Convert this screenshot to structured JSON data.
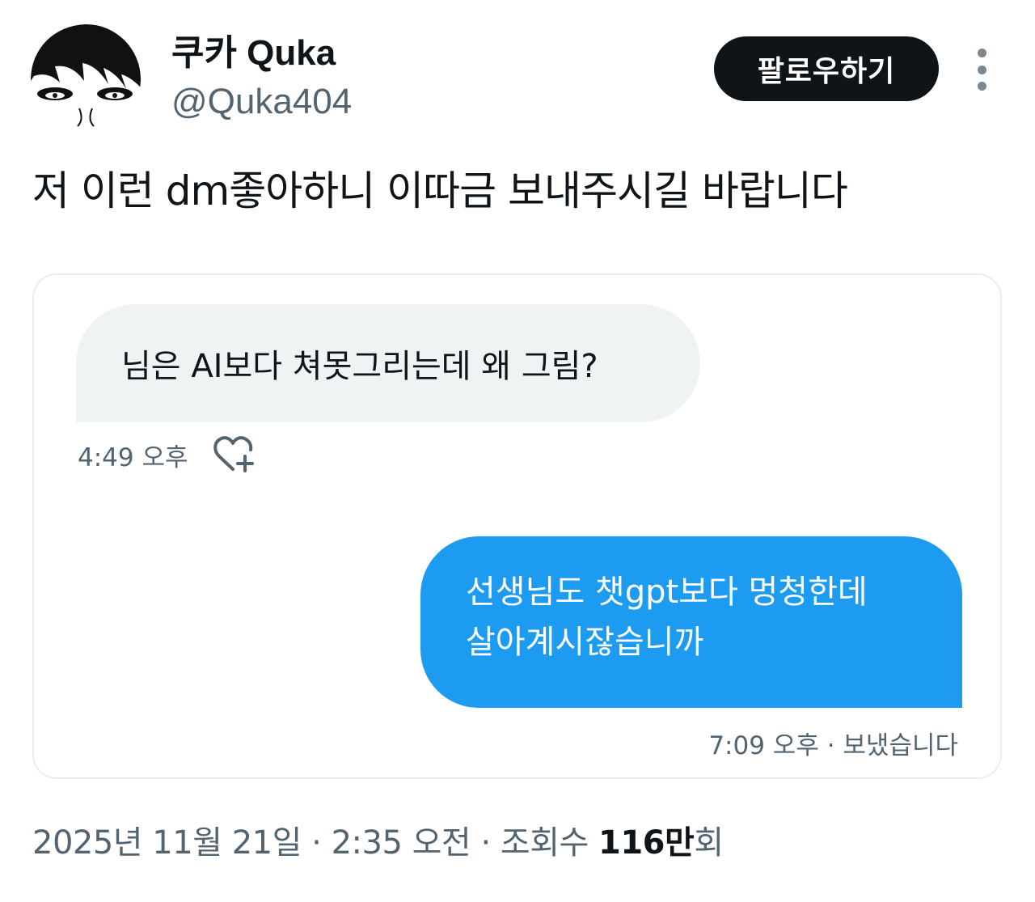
{
  "author": {
    "display_name": "쿠카 Quka",
    "handle": "@Quka404",
    "avatar_icon": "cartoon-face-avatar"
  },
  "actions": {
    "follow_label": "팔로우하기",
    "more_icon": "more-vertical-icon"
  },
  "tweet": {
    "text": "저 이런 dm좋아하니 이따금 보내주시길 바랍니다"
  },
  "dm_screenshot": {
    "received": {
      "text": "님은 AI보다 쳐못그리는데 왜 그림?",
      "time": "4:49 오후",
      "reaction_icon": "heart-add-icon"
    },
    "sent": {
      "line1": "선생님도 챗gpt보다 멍청한데",
      "line2": "살아계시잖습니까",
      "meta": "7:09 오후 · 보냈습니다"
    }
  },
  "footer": {
    "date": "2025년 11월 21일",
    "separator": "·",
    "time": "2:35 오전",
    "views_label": "조회수",
    "views_count": "116만",
    "views_suffix": "회"
  },
  "colors": {
    "text_primary": "#0f1419",
    "text_secondary": "#536471",
    "sent_bubble": "#1d9bf0",
    "received_bubble": "#eff3f4",
    "follow_button": "#0f1419"
  }
}
